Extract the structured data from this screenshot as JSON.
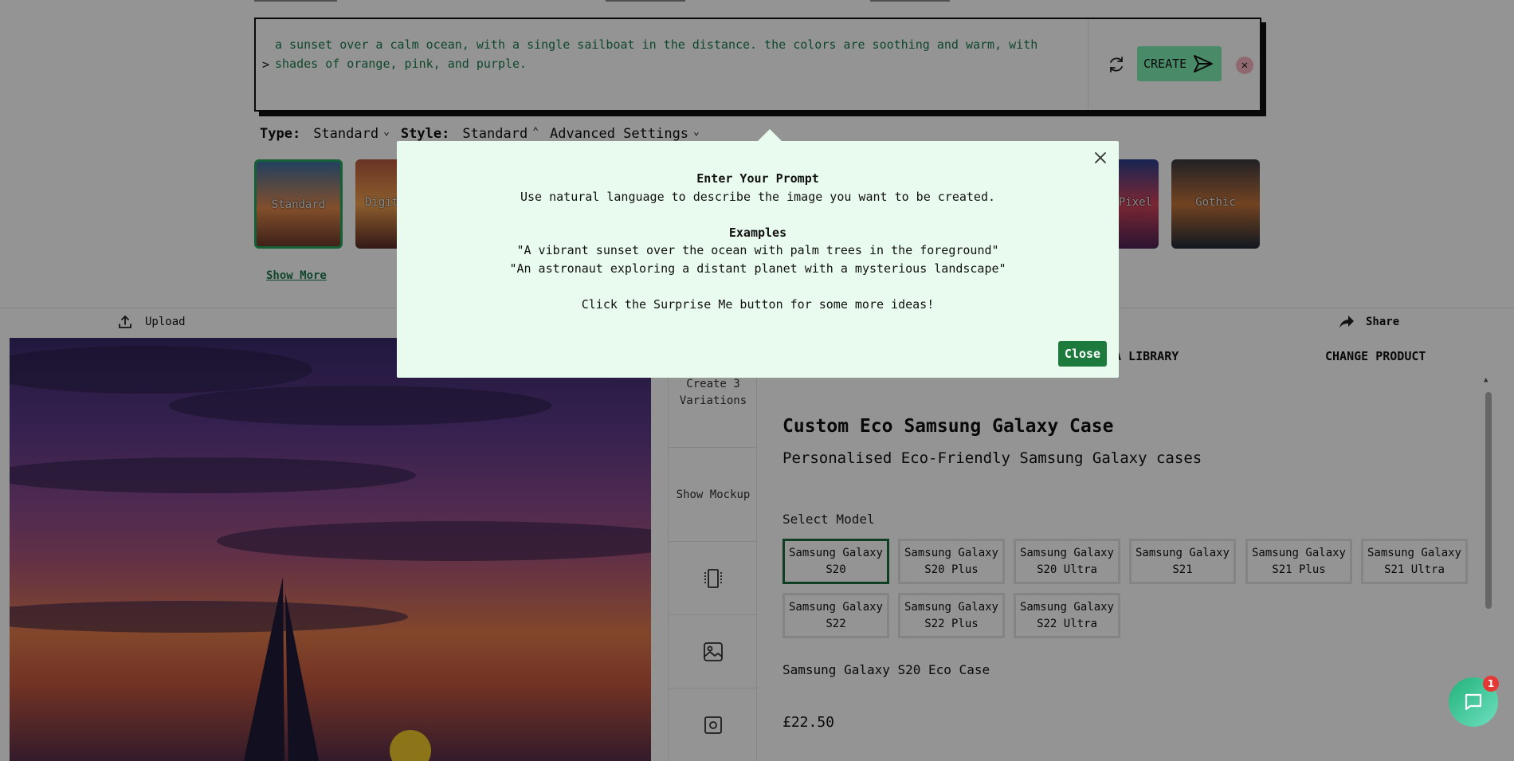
{
  "prompt": {
    "text": "a sunset over a calm ocean, with a single sailboat in the distance. the colors are soothing and warm, with shades of orange, pink, and purple.",
    "caret": ">",
    "create_label": "CREATE",
    "clear_label": "✕"
  },
  "settings": {
    "type_label": "Type:",
    "type_value": "Standard",
    "style_label": "Style:",
    "style_value": "Standard",
    "advanced_label": "Advanced Settings"
  },
  "styles": {
    "standard": "Standard",
    "digital": "Digit",
    "pixel": "Pixel",
    "gothic": "Gothic",
    "show_more": "Show More"
  },
  "toolbar": {
    "upload": "Upload",
    "share": "Share"
  },
  "side_actions": {
    "variations": "Create 3 Variations",
    "mockup": "Show Mockup"
  },
  "product_tabs": {
    "library": "A LIBRARY",
    "change_product": "CHANGE PRODUCT"
  },
  "product": {
    "title": "Custom Eco Samsung Galaxy Case",
    "subtitle": "Personalised Eco-Friendly Samsung Galaxy cases",
    "select_model_label": "Select Model",
    "models": [
      "Samsung Galaxy S20",
      "Samsung Galaxy S20 Plus",
      "Samsung Galaxy S20 Ultra",
      "Samsung Galaxy S21",
      "Samsung Galaxy S21 Plus",
      "Samsung Galaxy S21 Ultra",
      "Samsung Galaxy S22",
      "Samsung Galaxy S22 Plus",
      "Samsung Galaxy S22 Ultra"
    ],
    "selected_model": "Samsung Galaxy S20",
    "case_name": "Samsung Galaxy S20 Eco Case",
    "price": "£22.50"
  },
  "modal": {
    "heading": "Enter Your Prompt",
    "description": "Use natural language to describe the image you want to be created.",
    "examples_heading": "Examples",
    "example_1": "\"A vibrant sunset over the ocean with palm trees in the foreground\"",
    "example_2": "\"An astronaut exploring a distant planet with a mysterious landscape\"",
    "hint": "Click the Surprise Me button for some more ideas!",
    "close_label": "Close"
  },
  "chat": {
    "badge": "1"
  },
  "colors": {
    "accent_green": "#1c7a3c",
    "create_bg": "#7ef0b5",
    "modal_bg": "#e8fbee",
    "prompt_text": "#1a7a4c",
    "badge_red": "#e53935"
  },
  "icons": [
    "refresh-icon",
    "send-icon",
    "close-icon",
    "chevron-down-icon",
    "chevron-up-icon",
    "upload-icon",
    "share-icon",
    "crop-icon",
    "image-edit-icon",
    "frame-icon",
    "chat-icon"
  ]
}
